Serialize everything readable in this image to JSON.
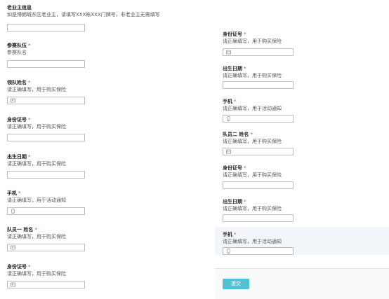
{
  "owner": {
    "label": "老业主信息",
    "hint": "如是博朗城东区老业主，请填写XXX栋XXX门牌号，非老业主无需填写"
  },
  "left_fields": [
    {
      "label": "参赛队伍",
      "required": "*",
      "hint": "参赛队名",
      "icon": ""
    },
    {
      "label": "领队姓名",
      "required": "*",
      "hint": "请正确填写，用于购买保险",
      "icon": "person-card-icon"
    },
    {
      "label": "身份证号",
      "required": "*",
      "hint": "请正确填写，用于购买保险",
      "icon": ""
    },
    {
      "label": "出生日期",
      "required": "*",
      "hint": "请正确填写，用于购买保险",
      "icon": ""
    },
    {
      "label": "手机",
      "required": "*",
      "hint": "请正确填写，用于活动通知",
      "icon": "phone-icon"
    },
    {
      "label": "队员一 姓名",
      "required": "*",
      "hint": "请正确填写，用于购买保险",
      "icon": "person-card-icon"
    },
    {
      "label": "身份证号",
      "required": "*",
      "hint": "请正确填写，用于购买保险",
      "icon": "person-card-icon"
    }
  ],
  "right_fields": [
    {
      "label": "身份证号",
      "required": "*",
      "hint": "请正确填写，用于购买保险",
      "icon": "person-card-icon"
    },
    {
      "label": "出生日期",
      "required": "*",
      "hint": "请正确填写，用于购买保险",
      "icon": ""
    },
    {
      "label": "手机",
      "required": "*",
      "hint": "请正确填写，用于活动通知",
      "icon": "phone-icon"
    },
    {
      "label": "队员二 姓名",
      "required": "*",
      "hint": "请正确填写，用于购买保险",
      "icon": "person-card-icon"
    },
    {
      "label": "身份证号",
      "required": "*",
      "hint": "请正确填写，用于购买保险",
      "icon": ""
    },
    {
      "label": "出生日期",
      "required": "*",
      "hint": "请正确填写，用于购买保险",
      "icon": ""
    },
    {
      "label": "手机",
      "required": "*",
      "hint": "请正确填写，用于活动通知",
      "icon": "phone-icon"
    }
  ],
  "submit_label": "提交",
  "colors": {
    "required": "#e0393e",
    "submit": "#4fc3cf",
    "highlight": "#f2f6fb"
  }
}
